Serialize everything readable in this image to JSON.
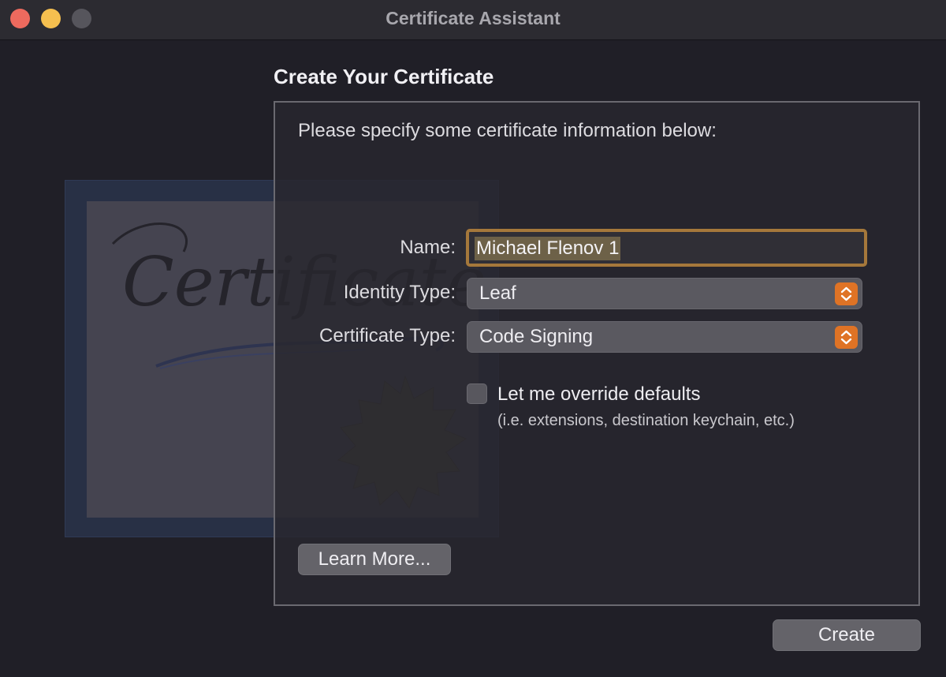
{
  "window": {
    "title": "Certificate Assistant"
  },
  "header": {
    "title": "Create Your Certificate"
  },
  "form": {
    "instruction": "Please specify some certificate information below:",
    "name_label": "Name:",
    "name_value": "Michael Flenov 1",
    "identity_type_label": "Identity Type:",
    "identity_type_value": "Leaf",
    "certificate_type_label": "Certificate Type:",
    "certificate_type_value": "Code Signing",
    "override_label": "Let me override defaults",
    "override_help": "(i.e. extensions, destination keychain, etc.)",
    "override_checked": false
  },
  "buttons": {
    "learn_more": "Learn More...",
    "create": "Create"
  },
  "artwork": {
    "certificate_word": "Certificate"
  },
  "colors": {
    "accent": "#df7325",
    "focus_ring": "#a5783b",
    "close": "#ed6a5e",
    "minimize": "#f5bf4f",
    "maximize": "#56555c"
  },
  "icons": [
    "close-icon",
    "minimize-icon",
    "maximize-icon",
    "up-down-chevron-icon"
  ]
}
